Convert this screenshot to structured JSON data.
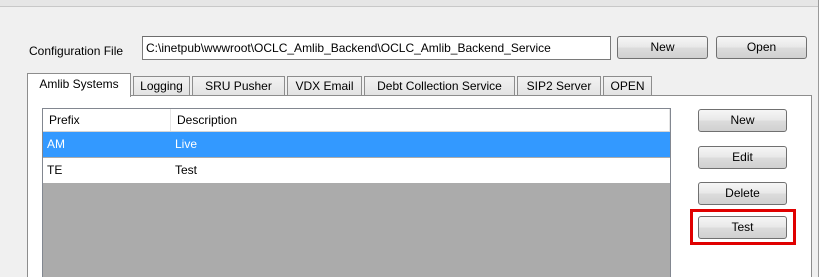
{
  "config": {
    "label": "Configuration File",
    "path": "C:\\inetpub\\wwwroot\\OCLC_Amlib_Backend\\OCLC_Amlib_Backend_Service",
    "new_label": "New",
    "open_label": "Open"
  },
  "tabs": [
    {
      "label": "Amlib Systems"
    },
    {
      "label": "Logging"
    },
    {
      "label": "SRU Pusher"
    },
    {
      "label": "VDX Email"
    },
    {
      "label": "Debt Collection Service"
    },
    {
      "label": "SIP2 Server"
    },
    {
      "label": "OPEN"
    }
  ],
  "systems_list": {
    "columns": [
      "Prefix",
      "Description"
    ],
    "rows": [
      {
        "prefix": "AM",
        "description": "Live",
        "selected": true
      },
      {
        "prefix": "TE",
        "description": "Test",
        "selected": false
      }
    ]
  },
  "actions": {
    "new_label": "New",
    "edit_label": "Edit",
    "delete_label": "Delete",
    "test_label": "Test"
  },
  "colors": {
    "selection": "#3399ff",
    "highlight_box": "#e00000"
  }
}
